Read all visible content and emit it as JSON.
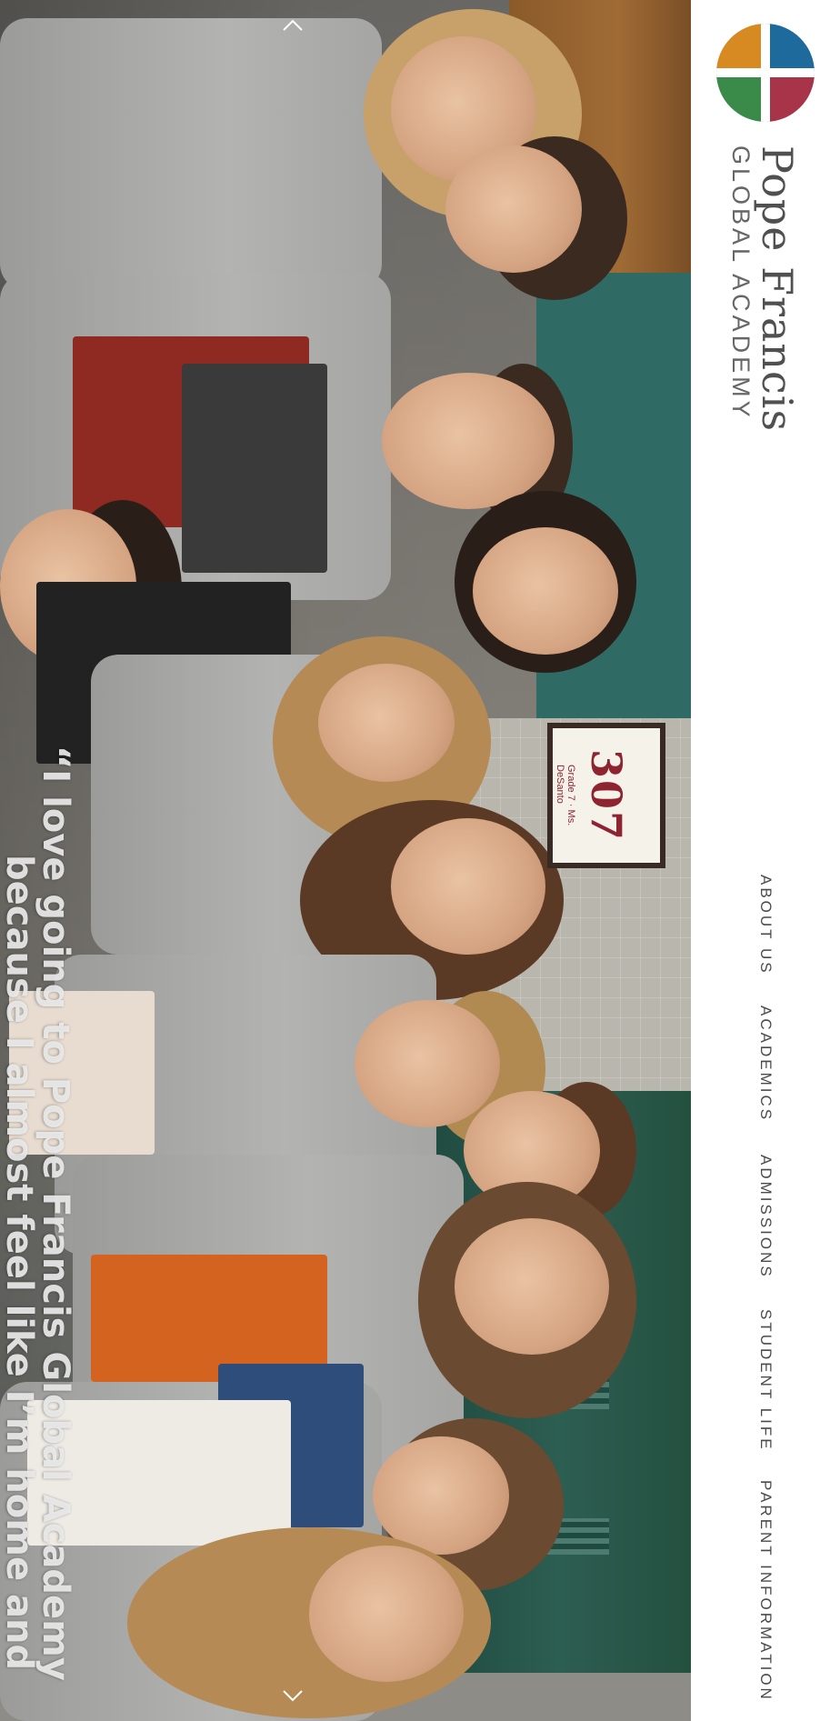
{
  "school": {
    "name": "Pope Francis",
    "subtitle": "GLOBAL ACADEMY"
  },
  "hero": {
    "quote_line1": "“I love going to Pope Francis Global Academy",
    "quote_line2": "because I almost feel like I’m home and",
    "room_number": "307",
    "room_grade": "Grade 7",
    "room_teacher": "Ms. DeSanto",
    "scroll_up_icon": "chevron-up-icon",
    "scroll_down_icon": "chevron-down-icon"
  },
  "nav": {
    "items": [
      {
        "label": "ABOUT US"
      },
      {
        "label": "ACADEMICS"
      },
      {
        "label": "ADMISSIONS"
      },
      {
        "label": "STUDENT LIFE"
      },
      {
        "label": "PARENT INFORMATION"
      }
    ]
  },
  "colors": {
    "logo_orange": "#d88a22",
    "logo_blue": "#1f6a9c",
    "logo_green": "#3a8a4a",
    "logo_red": "#a8344a",
    "nav_text": "#4a4a4a"
  }
}
